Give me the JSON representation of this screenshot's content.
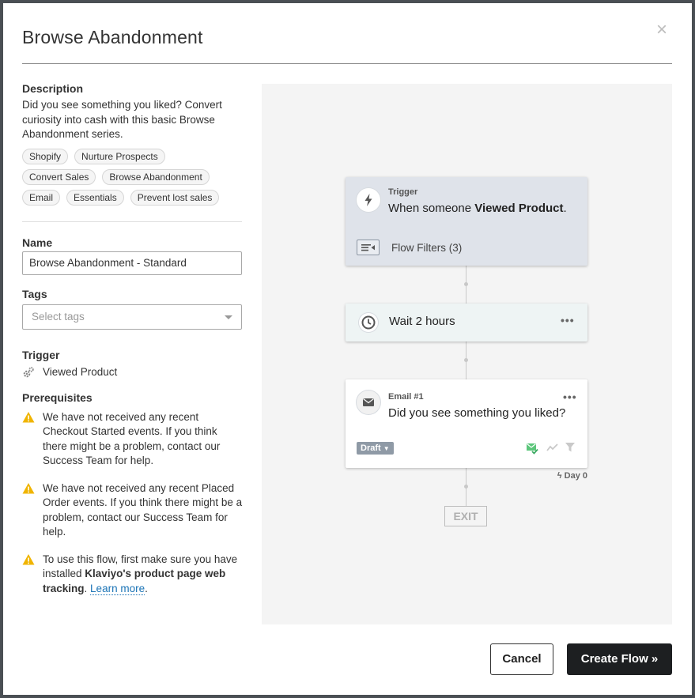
{
  "modal": {
    "title": "Browse Abandonment",
    "close_glyph": "×"
  },
  "description": {
    "label": "Description",
    "text": "Did you see something you liked? Convert curiosity into cash with this basic Browse Abandonment series."
  },
  "tags_list": [
    "Shopify",
    "Nurture Prospects",
    "Convert Sales",
    "Browse Abandonment",
    "Email",
    "Essentials",
    "Prevent lost sales"
  ],
  "name": {
    "label": "Name",
    "value": "Browse Abandonment - Standard"
  },
  "tags_field": {
    "label": "Tags",
    "placeholder": "Select tags"
  },
  "trigger_info": {
    "label": "Trigger",
    "value": "Viewed Product",
    "icon": "gears-icon"
  },
  "prerequisites": {
    "label": "Prerequisites",
    "items": [
      "We have not received any recent Checkout Started events. If you think there might be a problem, contact our Success Team for help.",
      "We have not received any recent Placed Order events. If you think there might be a problem, contact our Success Team for help."
    ],
    "last": {
      "prefix": "To use this flow, first make sure you have installed ",
      "bold": "Klaviyo's product page web tracking",
      "suffix_period": ". ",
      "link": "Learn more",
      "end": "."
    }
  },
  "flow": {
    "trigger_card": {
      "label": "Trigger",
      "text_prefix": "When someone ",
      "text_bold": "Viewed Product",
      "text_suffix": ".",
      "filters": "Flow Filters (3)",
      "icon": "lightning-icon"
    },
    "wait_card": {
      "text": "Wait 2 hours",
      "menu": "•••",
      "icon": "clock-icon"
    },
    "email_card": {
      "label": "Email #1",
      "text": "Did you see something you liked?",
      "status": "Draft",
      "menu": "•••",
      "icon": "envelope-icon"
    },
    "day_label": "Day 0",
    "exit": "EXIT"
  },
  "footer": {
    "cancel": "Cancel",
    "create": "Create Flow »"
  },
  "colors": {
    "primary_button": "#1d1f21",
    "trigger_card_bg": "#dfe3ea",
    "wait_card_bg": "#eef4f4",
    "canvas_bg": "#f4f4f4",
    "warning": "#f0b400",
    "link": "#1a73b6"
  }
}
